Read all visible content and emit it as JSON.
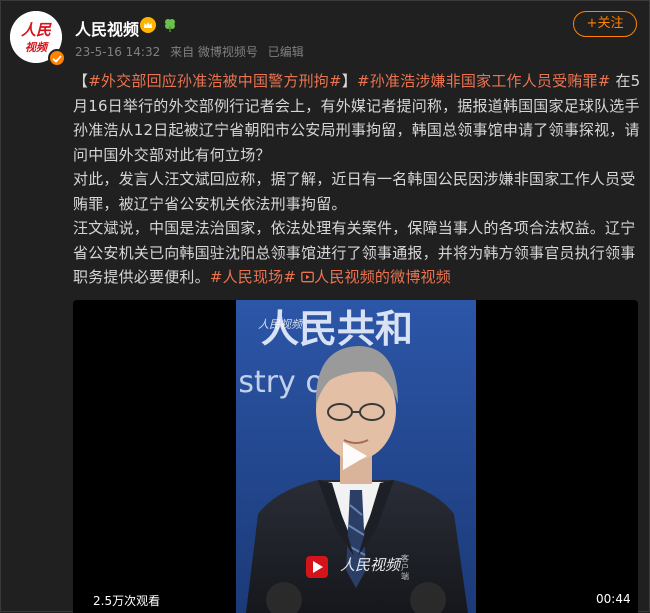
{
  "author": {
    "name": "人民视频",
    "avatar_text_top": "人民",
    "avatar_text_bottom": "视频"
  },
  "meta": {
    "time": "23-5-16 14:32",
    "source": "来自 微博视频号",
    "edited": "已编辑"
  },
  "follow_label": "+关注",
  "post": {
    "bracket_open": "【",
    "tag1": "#外交部回应孙准浩被中国警方刑拘#",
    "bracket_close": "】",
    "tag2": "#孙准浩涉嫌非国家工作人员受贿罪#",
    "para1_rest": " 在5月16日举行的外交部例行记者会上，有外媒记者提问称，据报道韩国国家足球队选手孙准浩从12日起被辽宁省朝阳市公安局刑事拘留，韩国总领事馆申请了领事探视，请问中国外交部对此有何立场？",
    "para2": "对此，发言人汪文斌回应称，据了解，近日有一名韩国公民因涉嫌非国家工作人员受贿罪，被辽宁省公安机关依法刑事拘留。",
    "para3": "汪文斌说，中国是法治国家，依法处理有关案件，保障当事人的各项合法权益。辽宁省公安机关已向韩国驻沈阳总领事馆进行了领事通报，并将为韩方领事官员执行领事职务提供必要便利。",
    "tag3": "#人民现场#",
    "video_link_icon": "video-link-icon",
    "video_link_label": "人民视频的微博视频"
  },
  "video": {
    "backdrop_text_top": "人民共和",
    "backdrop_text_mid": "istry of For",
    "backdrop_logo": "人民视频",
    "watermark": "人民视频",
    "watermark_sub": "客户端",
    "views": "2.5万次观看",
    "duration": "00:44"
  },
  "colors": {
    "accent": "#ff8200",
    "tag": "#eb7350",
    "background": "#202020",
    "text": "#d6d6d6",
    "brand_red": "#d4131a",
    "backdrop_blue": "#2a4f9e"
  }
}
